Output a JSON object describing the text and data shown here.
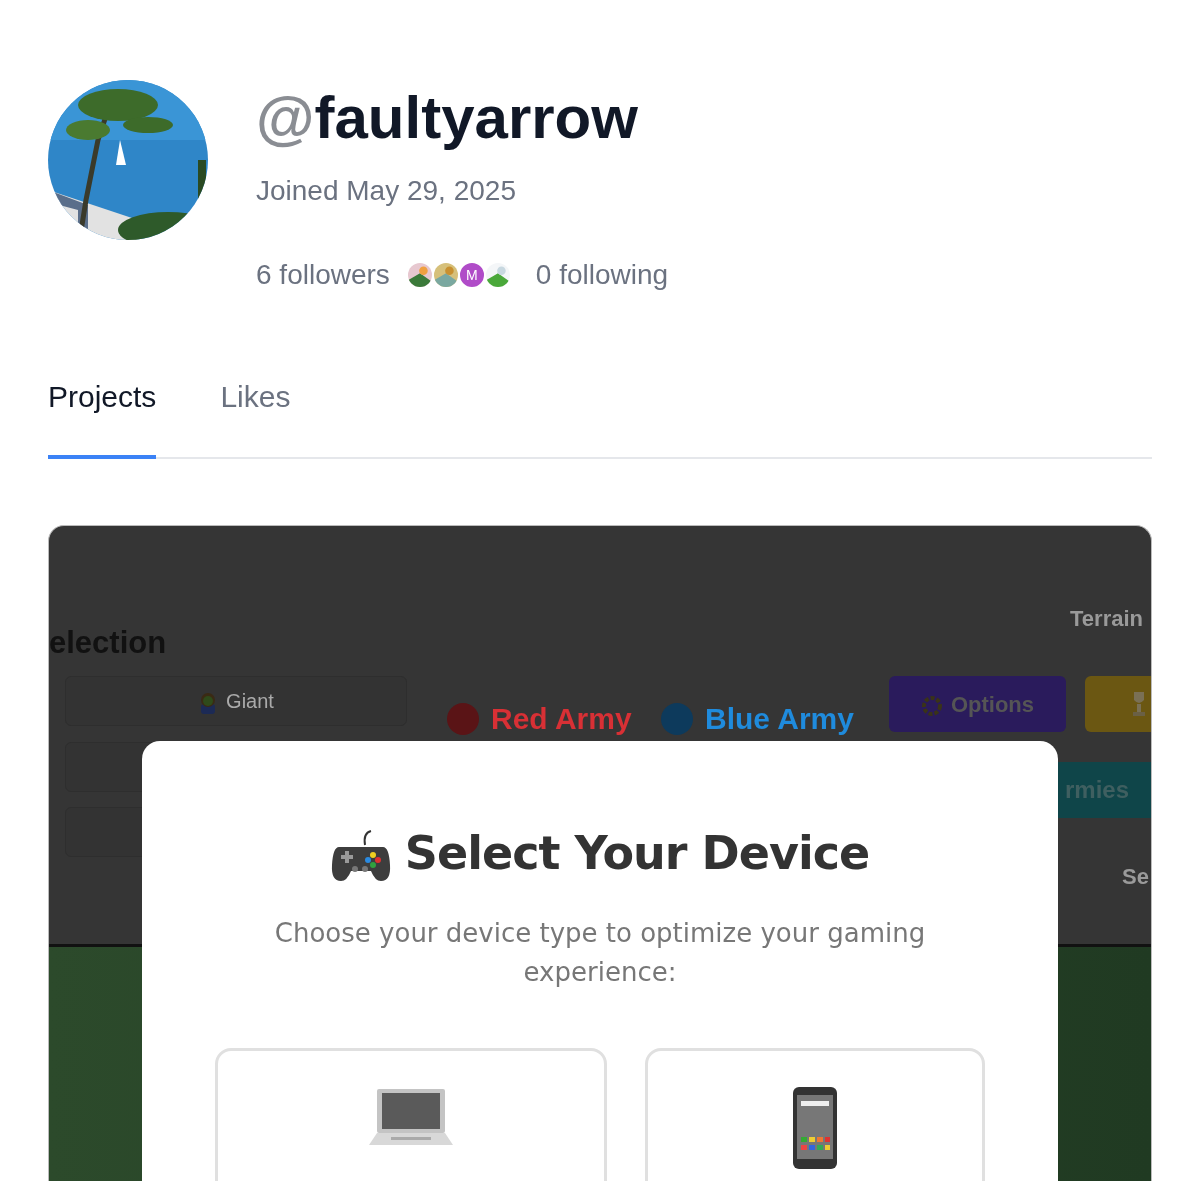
{
  "profile": {
    "handle_prefix": "@",
    "username": "faultyarrow",
    "joined": "Joined May 29, 2025",
    "followers": "6 followers",
    "follower_avatars": [
      {
        "kind": "picture"
      },
      {
        "kind": "picture"
      },
      {
        "kind": "letter",
        "letter": "M",
        "color": "#b04cc8"
      },
      {
        "kind": "picture"
      }
    ],
    "following": "0 following"
  },
  "tabs": [
    {
      "label": "Projects",
      "selected": true
    },
    {
      "label": "Likes",
      "selected": false
    }
  ],
  "project_preview": {
    "heading": "election",
    "terrain_label": "Terrain",
    "unit_buttons": [
      {
        "kind": "labeled",
        "label": "Giant"
      },
      {
        "kind": "blank"
      },
      {
        "kind": "blank"
      }
    ],
    "armies": [
      {
        "label": "Red Army",
        "color": "#5a1416"
      },
      {
        "label": "Blue Army",
        "color": "#0d3a5c"
      }
    ],
    "action_buttons": [
      {
        "kind": "options",
        "label": "Options"
      },
      {
        "kind": "trophy"
      },
      {
        "kind": "armies",
        "label": "rmies"
      }
    ],
    "side_text": "Se",
    "modal": {
      "title": "Select Your Device",
      "subtitle": "Choose your device type to optimize your gaming experience:",
      "devices": [
        {
          "kind": "laptop"
        },
        {
          "kind": "phone"
        }
      ]
    }
  }
}
